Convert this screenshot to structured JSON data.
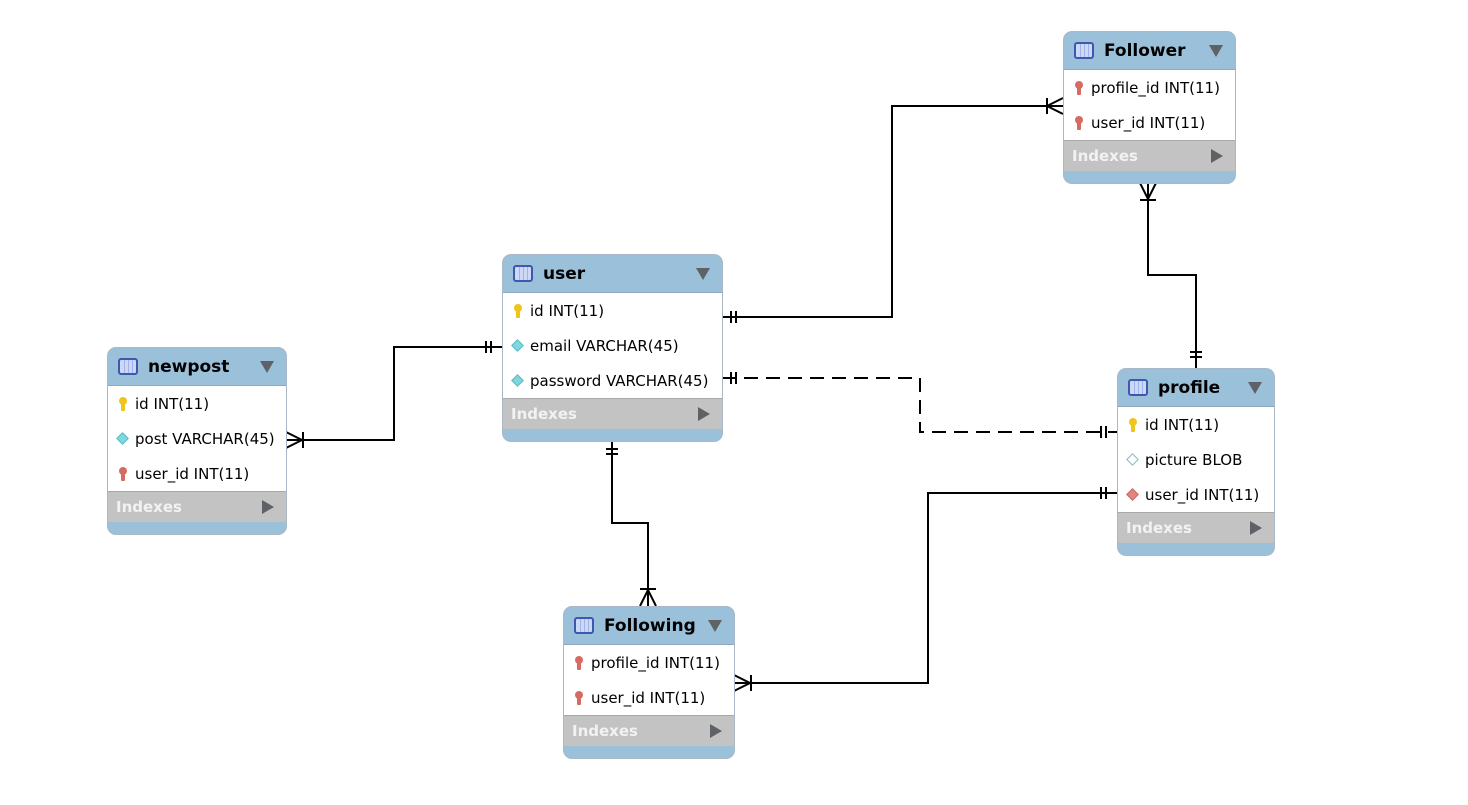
{
  "tables": {
    "follower": {
      "name": "Follower",
      "columns": [
        {
          "label": "profile_id INT(11)",
          "icon": "foreign-key-icon"
        },
        {
          "label": "user_id INT(11)",
          "icon": "foreign-key-icon"
        }
      ],
      "indexes": "Indexes"
    },
    "user": {
      "name": "user",
      "columns": [
        {
          "label": "id INT(11)",
          "icon": "primary-key-icon"
        },
        {
          "label": "email VARCHAR(45)",
          "icon": "column-diamond-icon"
        },
        {
          "label": "password VARCHAR(45)",
          "icon": "column-diamond-icon"
        }
      ],
      "indexes": "Indexes"
    },
    "newpost": {
      "name": "newpost",
      "columns": [
        {
          "label": "id INT(11)",
          "icon": "primary-key-icon"
        },
        {
          "label": "post VARCHAR(45)",
          "icon": "column-diamond-icon"
        },
        {
          "label": "user_id INT(11)",
          "icon": "foreign-key-icon"
        }
      ],
      "indexes": "Indexes"
    },
    "profile": {
      "name": "profile",
      "columns": [
        {
          "label": "id INT(11)",
          "icon": "primary-key-icon"
        },
        {
          "label": "picture BLOB",
          "icon": "nullable-diamond-icon"
        },
        {
          "label": "user_id INT(11)",
          "icon": "foreign-key-diamond-icon"
        }
      ],
      "indexes": "Indexes"
    },
    "following": {
      "name": "Following",
      "columns": [
        {
          "label": "profile_id INT(11)",
          "icon": "foreign-key-icon"
        },
        {
          "label": "user_id INT(11)",
          "icon": "foreign-key-icon"
        }
      ],
      "indexes": "Indexes"
    }
  },
  "relationships": [
    {
      "from": "user",
      "to": "Follower",
      "type": "one-to-many"
    },
    {
      "from": "profile",
      "to": "Follower",
      "type": "one-to-many"
    },
    {
      "from": "user",
      "to": "profile",
      "type": "one-to-one",
      "style": "dashed"
    },
    {
      "from": "user",
      "to": "newpost",
      "type": "one-to-many"
    },
    {
      "from": "user",
      "to": "Following",
      "type": "one-to-many"
    },
    {
      "from": "profile",
      "to": "Following",
      "type": "one-to-many"
    }
  ],
  "colors": {
    "header": "#9bc0da",
    "indexes": "#c3c3c3",
    "line": "#000000"
  }
}
